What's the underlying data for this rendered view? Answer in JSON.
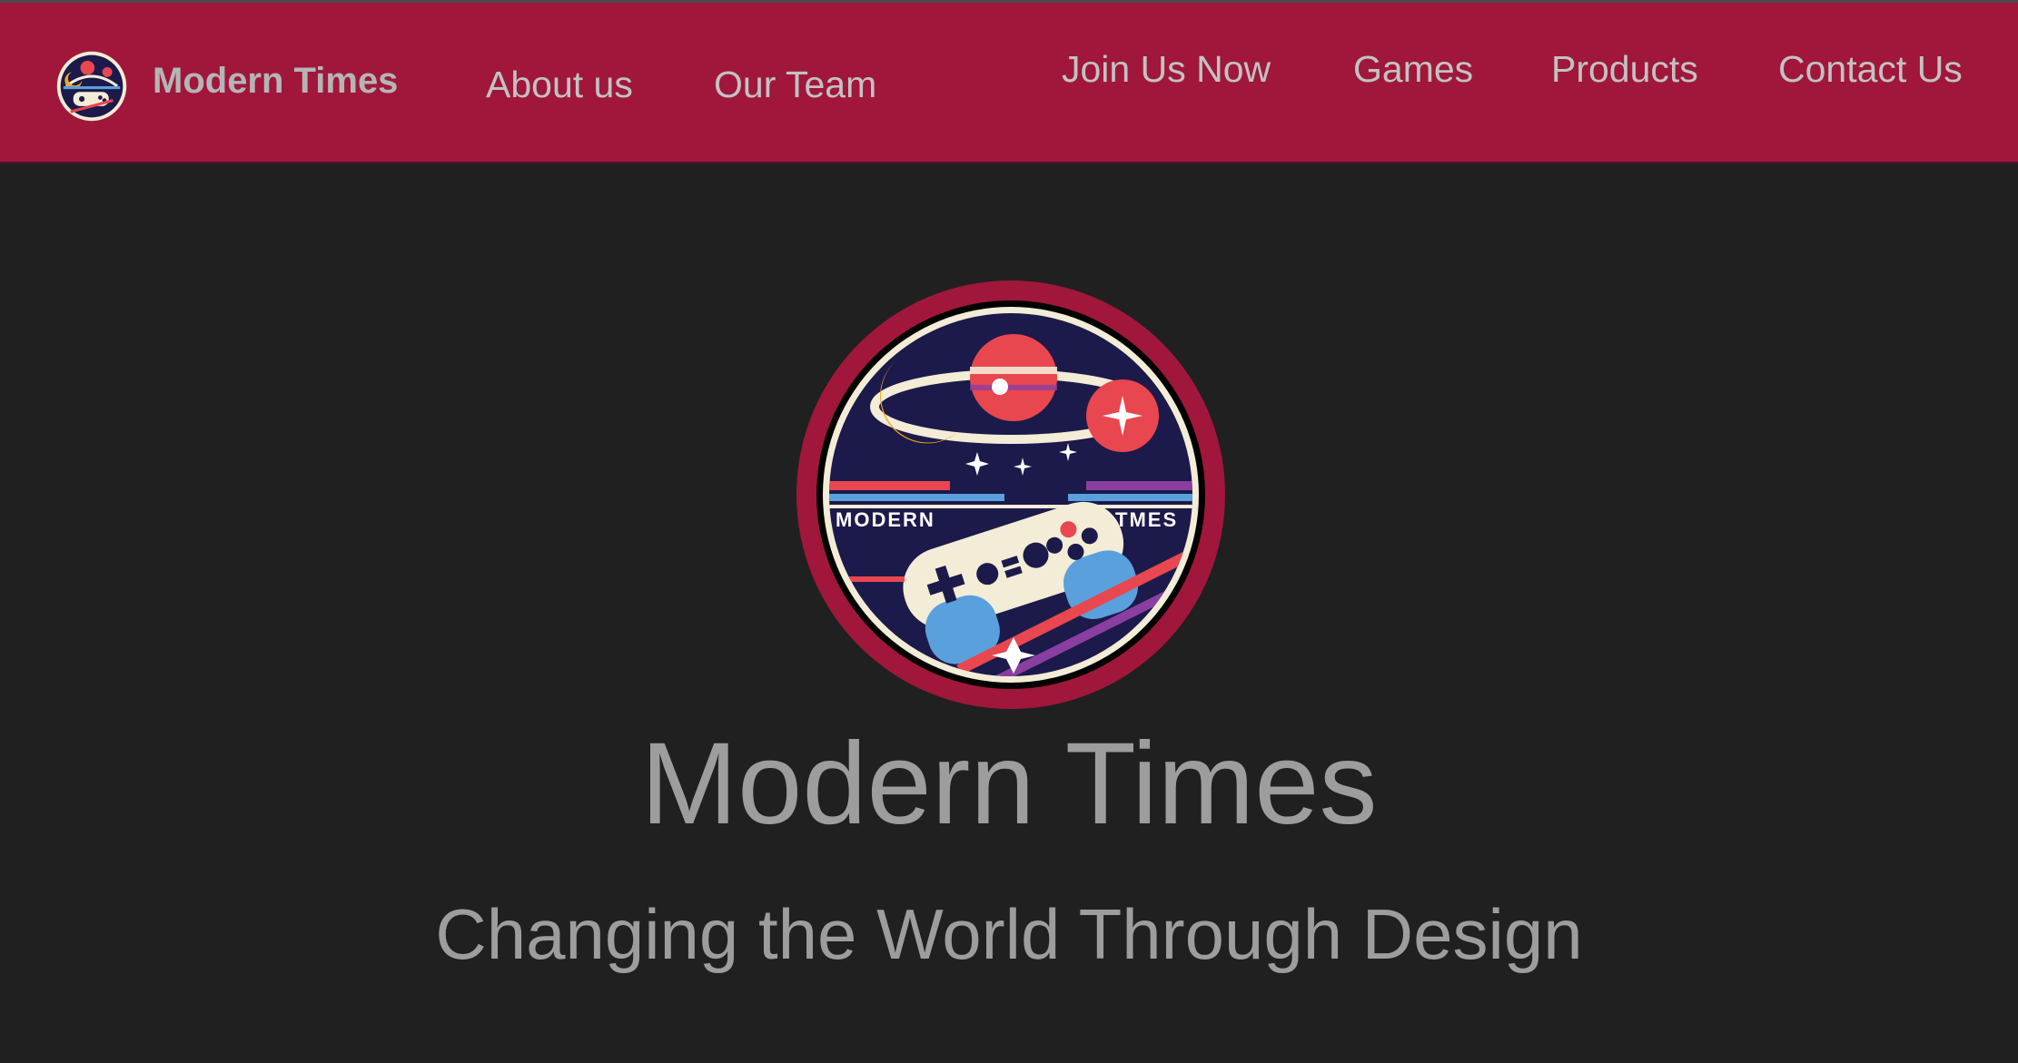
{
  "header": {
    "brand_name": "Modern Times",
    "nav": {
      "about": "About us",
      "team": "Our Team",
      "join": "Join Us Now",
      "games": "Games",
      "products": "Products",
      "contact": "Contact Us"
    }
  },
  "hero": {
    "logo_text_left": "MODERN",
    "logo_text_right": "TMES",
    "title": "Modern Times",
    "subtitle": "Changing the World Through Design"
  },
  "colors": {
    "header_bg": "#a0173b",
    "page_bg": "#202020",
    "nav_text": "#c2c2c2",
    "hero_text": "#9d9d9d",
    "logo_ring": "#a0173b",
    "logo_inner": "#1c1a4a"
  },
  "icons": {
    "brand": "modern-times-logo-icon",
    "hero": "modern-times-emblem"
  }
}
